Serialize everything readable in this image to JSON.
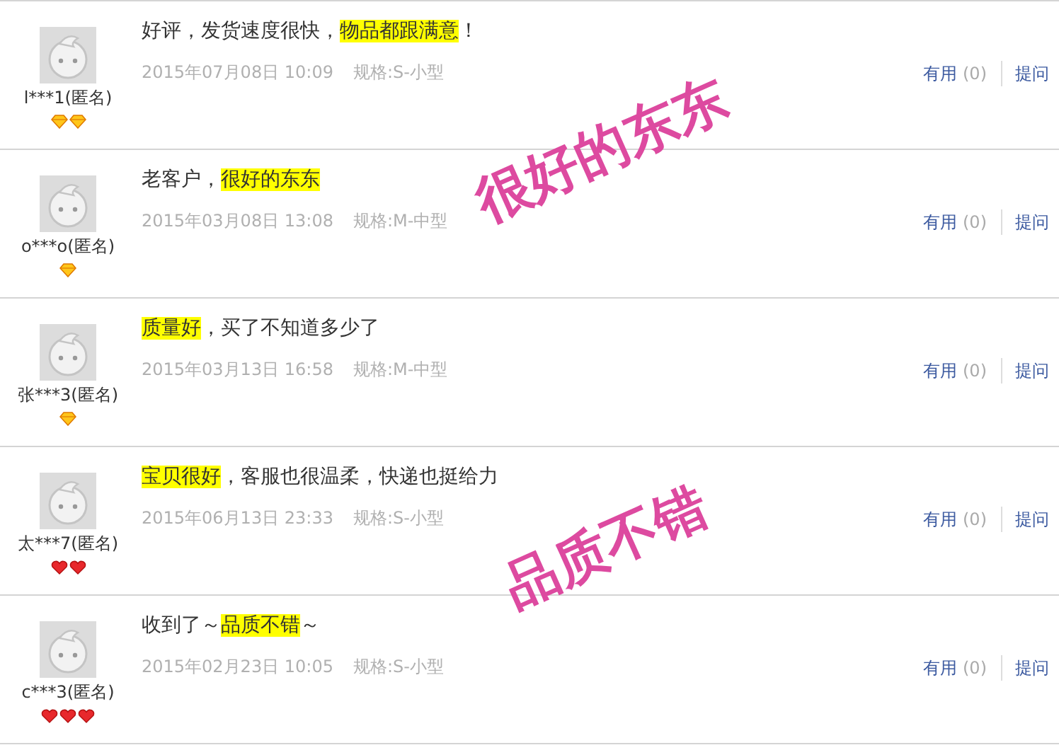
{
  "reviews": [
    {
      "user": "l***1(匿名)",
      "badges": [
        {
          "kind": "diamond"
        },
        {
          "kind": "diamond"
        }
      ],
      "comment": [
        {
          "text": "好评，发货速度很快，",
          "highlighted": false
        },
        {
          "text": "物品都跟满意",
          "highlighted": true
        },
        {
          "text": "！",
          "highlighted": false
        }
      ],
      "date": "2015年07月08日 10:09",
      "spec": "规格:S-小型",
      "useful_label": "有用",
      "useful_count": "(0)",
      "ask": "提问"
    },
    {
      "user": "o***o(匿名)",
      "badges": [
        {
          "kind": "diamond"
        }
      ],
      "comment": [
        {
          "text": "老客户，",
          "highlighted": false
        },
        {
          "text": "很好的东东",
          "highlighted": true
        }
      ],
      "date": "2015年03月08日 13:08",
      "spec": "规格:M-中型",
      "useful_label": "有用",
      "useful_count": "(0)",
      "ask": "提问"
    },
    {
      "user": "张***3(匿名)",
      "badges": [
        {
          "kind": "diamond"
        }
      ],
      "comment": [
        {
          "text": "质量好",
          "highlighted": true
        },
        {
          "text": "，买了不知道多少了",
          "highlighted": false
        }
      ],
      "date": "2015年03月13日 16:58",
      "spec": "规格:M-中型",
      "useful_label": "有用",
      "useful_count": "(0)",
      "ask": "提问"
    },
    {
      "user": "太***7(匿名)",
      "badges": [
        {
          "kind": "heart"
        },
        {
          "kind": "heart"
        }
      ],
      "comment": [
        {
          "text": "宝贝很好",
          "highlighted": true
        },
        {
          "text": "，客服也很温柔，快递也挺给力",
          "highlighted": false
        }
      ],
      "date": "2015年06月13日 23:33",
      "spec": "规格:S-小型",
      "useful_label": "有用",
      "useful_count": "(0)",
      "ask": "提问"
    },
    {
      "user": "c***3(匿名)",
      "badges": [
        {
          "kind": "heart"
        },
        {
          "kind": "heart"
        },
        {
          "kind": "heart"
        }
      ],
      "comment": [
        {
          "text": "收到了～",
          "highlighted": false
        },
        {
          "text": "品质不错",
          "highlighted": true
        },
        {
          "text": "～",
          "highlighted": false
        }
      ],
      "date": "2015年02月23日 10:05",
      "spec": "规格:S-小型",
      "useful_label": "有用",
      "useful_count": "(0)",
      "ask": "提问"
    }
  ],
  "stamps": [
    {
      "text": "很好的东东"
    },
    {
      "text": "品质不错"
    }
  ]
}
